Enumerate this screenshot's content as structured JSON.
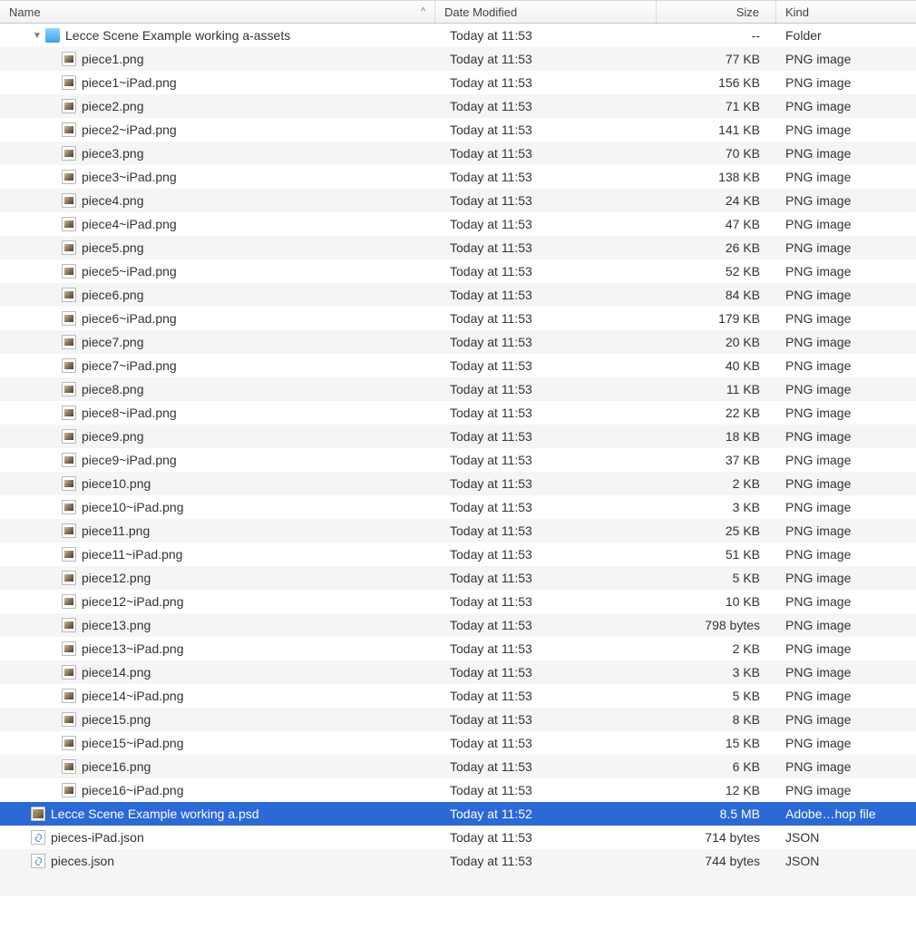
{
  "columns": {
    "name": "Name",
    "date": "Date Modified",
    "size": "Size",
    "kind": "Kind"
  },
  "sort_indicator": "^",
  "rows": [
    {
      "indent": 1,
      "disclosure": "▼",
      "icon": "folder",
      "name": "Lecce Scene Example working a-assets",
      "date": "Today at 11:53",
      "size": "--",
      "kind": "Folder",
      "selected": false
    },
    {
      "indent": 2,
      "icon": "img",
      "name": "piece1.png",
      "date": "Today at 11:53",
      "size": "77 KB",
      "kind": "PNG image"
    },
    {
      "indent": 2,
      "icon": "img",
      "name": "piece1~iPad.png",
      "date": "Today at 11:53",
      "size": "156 KB",
      "kind": "PNG image"
    },
    {
      "indent": 2,
      "icon": "img",
      "name": "piece2.png",
      "date": "Today at 11:53",
      "size": "71 KB",
      "kind": "PNG image"
    },
    {
      "indent": 2,
      "icon": "img",
      "name": "piece2~iPad.png",
      "date": "Today at 11:53",
      "size": "141 KB",
      "kind": "PNG image"
    },
    {
      "indent": 2,
      "icon": "img",
      "name": "piece3.png",
      "date": "Today at 11:53",
      "size": "70 KB",
      "kind": "PNG image"
    },
    {
      "indent": 2,
      "icon": "img",
      "name": "piece3~iPad.png",
      "date": "Today at 11:53",
      "size": "138 KB",
      "kind": "PNG image"
    },
    {
      "indent": 2,
      "icon": "img",
      "name": "piece4.png",
      "date": "Today at 11:53",
      "size": "24 KB",
      "kind": "PNG image"
    },
    {
      "indent": 2,
      "icon": "img",
      "name": "piece4~iPad.png",
      "date": "Today at 11:53",
      "size": "47 KB",
      "kind": "PNG image"
    },
    {
      "indent": 2,
      "icon": "img",
      "name": "piece5.png",
      "date": "Today at 11:53",
      "size": "26 KB",
      "kind": "PNG image"
    },
    {
      "indent": 2,
      "icon": "img",
      "name": "piece5~iPad.png",
      "date": "Today at 11:53",
      "size": "52 KB",
      "kind": "PNG image"
    },
    {
      "indent": 2,
      "icon": "img",
      "name": "piece6.png",
      "date": "Today at 11:53",
      "size": "84 KB",
      "kind": "PNG image"
    },
    {
      "indent": 2,
      "icon": "img",
      "name": "piece6~iPad.png",
      "date": "Today at 11:53",
      "size": "179 KB",
      "kind": "PNG image"
    },
    {
      "indent": 2,
      "icon": "img",
      "name": "piece7.png",
      "date": "Today at 11:53",
      "size": "20 KB",
      "kind": "PNG image"
    },
    {
      "indent": 2,
      "icon": "img",
      "name": "piece7~iPad.png",
      "date": "Today at 11:53",
      "size": "40 KB",
      "kind": "PNG image"
    },
    {
      "indent": 2,
      "icon": "img",
      "name": "piece8.png",
      "date": "Today at 11:53",
      "size": "11 KB",
      "kind": "PNG image"
    },
    {
      "indent": 2,
      "icon": "img",
      "name": "piece8~iPad.png",
      "date": "Today at 11:53",
      "size": "22 KB",
      "kind": "PNG image"
    },
    {
      "indent": 2,
      "icon": "img",
      "name": "piece9.png",
      "date": "Today at 11:53",
      "size": "18 KB",
      "kind": "PNG image"
    },
    {
      "indent": 2,
      "icon": "img",
      "name": "piece9~iPad.png",
      "date": "Today at 11:53",
      "size": "37 KB",
      "kind": "PNG image"
    },
    {
      "indent": 2,
      "icon": "img",
      "name": "piece10.png",
      "date": "Today at 11:53",
      "size": "2 KB",
      "kind": "PNG image"
    },
    {
      "indent": 2,
      "icon": "img",
      "name": "piece10~iPad.png",
      "date": "Today at 11:53",
      "size": "3 KB",
      "kind": "PNG image"
    },
    {
      "indent": 2,
      "icon": "img",
      "name": "piece11.png",
      "date": "Today at 11:53",
      "size": "25 KB",
      "kind": "PNG image"
    },
    {
      "indent": 2,
      "icon": "img",
      "name": "piece11~iPad.png",
      "date": "Today at 11:53",
      "size": "51 KB",
      "kind": "PNG image"
    },
    {
      "indent": 2,
      "icon": "img",
      "name": "piece12.png",
      "date": "Today at 11:53",
      "size": "5 KB",
      "kind": "PNG image"
    },
    {
      "indent": 2,
      "icon": "img",
      "name": "piece12~iPad.png",
      "date": "Today at 11:53",
      "size": "10 KB",
      "kind": "PNG image"
    },
    {
      "indent": 2,
      "icon": "img",
      "name": "piece13.png",
      "date": "Today at 11:53",
      "size": "798 bytes",
      "kind": "PNG image"
    },
    {
      "indent": 2,
      "icon": "img",
      "name": "piece13~iPad.png",
      "date": "Today at 11:53",
      "size": "2 KB",
      "kind": "PNG image"
    },
    {
      "indent": 2,
      "icon": "img",
      "name": "piece14.png",
      "date": "Today at 11:53",
      "size": "3 KB",
      "kind": "PNG image"
    },
    {
      "indent": 2,
      "icon": "img",
      "name": "piece14~iPad.png",
      "date": "Today at 11:53",
      "size": "5 KB",
      "kind": "PNG image"
    },
    {
      "indent": 2,
      "icon": "img",
      "name": "piece15.png",
      "date": "Today at 11:53",
      "size": "8 KB",
      "kind": "PNG image"
    },
    {
      "indent": 2,
      "icon": "img",
      "name": "piece15~iPad.png",
      "date": "Today at 11:53",
      "size": "15 KB",
      "kind": "PNG image"
    },
    {
      "indent": 2,
      "icon": "img",
      "name": "piece16.png",
      "date": "Today at 11:53",
      "size": "6 KB",
      "kind": "PNG image"
    },
    {
      "indent": 2,
      "icon": "img",
      "name": "piece16~iPad.png",
      "date": "Today at 11:53",
      "size": "12 KB",
      "kind": "PNG image"
    },
    {
      "indent": 1,
      "icon": "psd",
      "name": "Lecce Scene Example working a.psd",
      "date": "Today at 11:52",
      "size": "8.5 MB",
      "kind": "Adobe…hop file",
      "selected": true
    },
    {
      "indent": 1,
      "icon": "json",
      "name": "pieces-iPad.json",
      "date": "Today at 11:53",
      "size": "714 bytes",
      "kind": "JSON"
    },
    {
      "indent": 1,
      "icon": "json",
      "name": "pieces.json",
      "date": "Today at 11:53",
      "size": "744 bytes",
      "kind": "JSON"
    }
  ]
}
